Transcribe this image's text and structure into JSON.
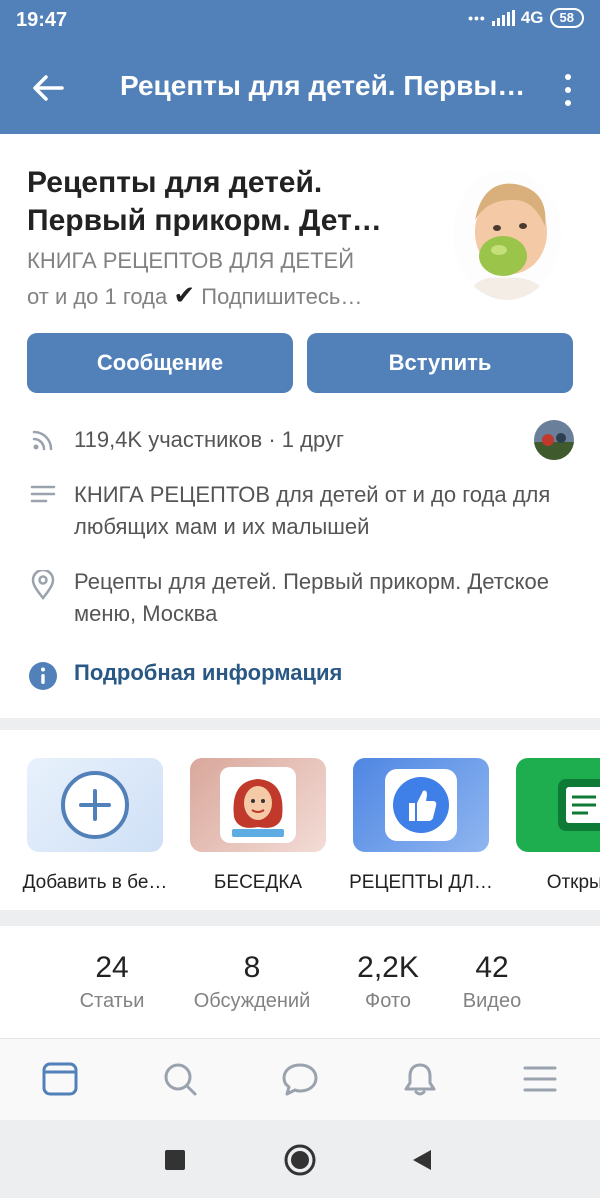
{
  "status_bar": {
    "time": "19:47",
    "network": "4G",
    "battery": "58"
  },
  "app_bar": {
    "title": "Рецепты для детей. Первы…"
  },
  "profile": {
    "name_line1": "Рецепты для детей.",
    "name_line2": "Первый прикорм. Дет…",
    "status_line1": "КНИГА РЕЦЕПТОВ ДЛЯ ДЕТЕЙ",
    "status_line2_prefix": "от и до 1 года ",
    "status_check": "✔",
    "status_line2_suffix": " Подпишитесь…",
    "message_button": "Сообщение",
    "join_button": "Вступить"
  },
  "info": {
    "members": "119,4K участников · 1 друг",
    "description": "КНИГА РЕЦЕПТОВ для детей от и до года для любящих мам и их малышей",
    "address": "Рецепты для детей. Первый прикорм. Детское меню, Москва",
    "more_info": "Подробная информация"
  },
  "apps": [
    {
      "label": "Добавить в бе…",
      "icon": "add-icon"
    },
    {
      "label": "БЕСЕДКА",
      "icon": "girl-avatar-icon"
    },
    {
      "label": "РЕЦЕПТЫ ДЛ…",
      "icon": "thumbs-up-icon"
    },
    {
      "label": "Открыть",
      "icon": "document-icon"
    }
  ],
  "counters": [
    {
      "value": "24",
      "label": "Статьи"
    },
    {
      "value": "8",
      "label": "Обсуждений"
    },
    {
      "value": "2,2K",
      "label": "Фото"
    },
    {
      "value": "42",
      "label": "Видео"
    }
  ],
  "bottom_nav": [
    "news-icon",
    "search-icon",
    "messages-icon",
    "notifications-icon",
    "menu-icon"
  ],
  "colors": {
    "accent": "#5181b8",
    "link": "#2a5885",
    "secondary_text": "#828282"
  }
}
